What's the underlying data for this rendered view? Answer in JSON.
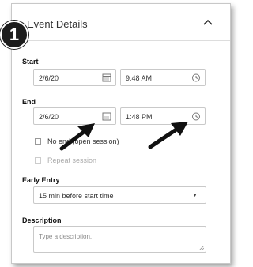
{
  "step_number": "1",
  "header": {
    "title": "Event Details"
  },
  "start": {
    "label": "Start",
    "date": "2/6/20",
    "time": "9:48 AM"
  },
  "end": {
    "label": "End",
    "date": "2/6/20",
    "time": "1:48 PM"
  },
  "options": {
    "no_end_label": "No end (open session)",
    "repeat_label": "Repeat session"
  },
  "early_entry": {
    "label": "Early Entry",
    "value": "15 min before start time"
  },
  "description": {
    "label": "Description",
    "placeholder": "Type a description."
  },
  "colors": {
    "badge": "#1d1d1d",
    "border": "#c9c9c9",
    "arrow": "#111111"
  }
}
